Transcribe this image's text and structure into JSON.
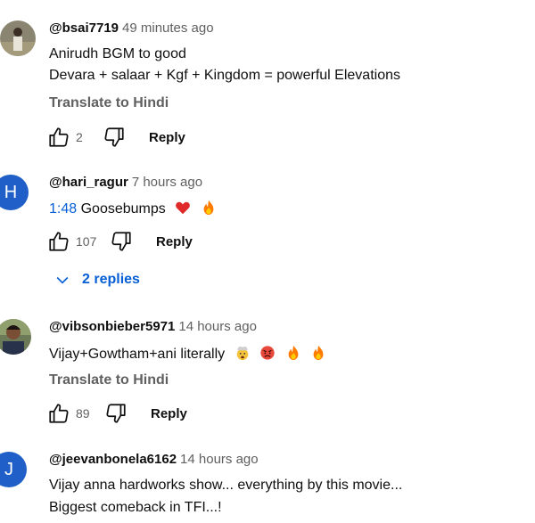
{
  "comments": [
    {
      "author": "@bsai7719",
      "time": "49 minutes ago",
      "lines": [
        "Anirudh BGM to good",
        "Devara + salaar + Kgf + Kingdom = powerful Elevations"
      ],
      "translate": "Translate to Hindi",
      "likes": "2",
      "reply_label": "Reply"
    },
    {
      "author": "@hari_ragur",
      "time": "7 hours ago",
      "avatar_letter": "H",
      "timestamp_link": "1:48",
      "text": "Goosebumps",
      "likes": "107",
      "reply_label": "Reply",
      "replies_label": "2 replies"
    },
    {
      "author": "@vibsonbieber5971",
      "time": "14 hours ago",
      "text": "Vijay+Gowtham+ani literally",
      "translate": "Translate to Hindi",
      "likes": "89",
      "reply_label": "Reply"
    },
    {
      "author": "@jeevanbonela6162",
      "time": "14 hours ago",
      "avatar_letter": "J",
      "lines": [
        "Vijay anna hardworks show... everything by this movie...",
        "Biggest comeback in TFI...!"
      ]
    }
  ],
  "colors": {
    "avatar_h": "#1f5fc7",
    "avatar_j": "#1f5fc7",
    "link": "#065fd4",
    "meta": "#606060"
  },
  "icons": {
    "like": "thumbs-up-icon",
    "dislike": "thumbs-down-icon",
    "chevron": "chevron-down-icon"
  }
}
